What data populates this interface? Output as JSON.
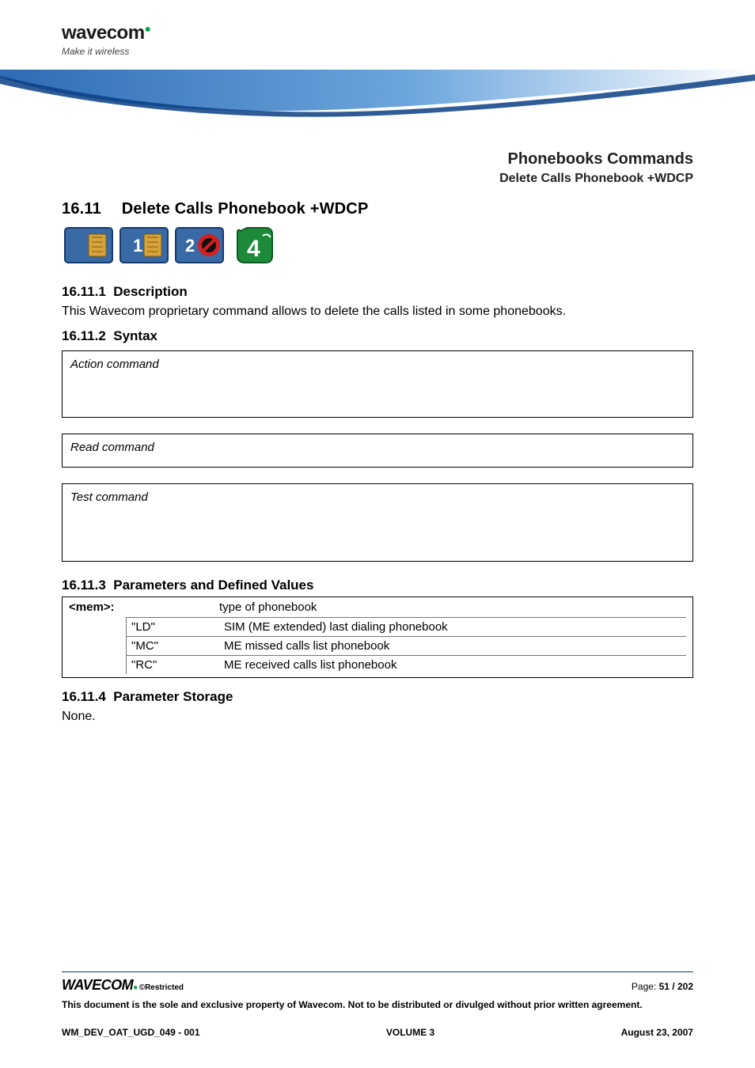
{
  "header": {
    "brand": "wavecom",
    "tagline": "Make it wireless"
  },
  "titles": {
    "chapter": "Phonebooks Commands",
    "subchapter": "Delete Calls Phonebook +WDCP"
  },
  "section": {
    "number": "16.11",
    "title": "Delete Calls Phonebook +WDCP"
  },
  "subs": {
    "desc_num": "16.11.1",
    "desc_title": "Description",
    "desc_body": "This Wavecom proprietary command allows to delete the calls listed in some phonebooks.",
    "syntax_num": "16.11.2",
    "syntax_title": "Syntax",
    "action_label": "Action command",
    "read_label": "Read command",
    "test_label": "Test command",
    "params_num": "16.11.3",
    "params_title": "Parameters and Defined Values",
    "storage_num": "16.11.4",
    "storage_title": "Parameter Storage",
    "storage_body": "None."
  },
  "params": {
    "name": "<mem>:",
    "type_label": "type of phonebook",
    "rows": [
      {
        "code": "\"LD\"",
        "desc": "SIM (ME extended) last dialing phonebook"
      },
      {
        "code": "\"MC\"",
        "desc": "ME missed calls list phonebook"
      },
      {
        "code": "\"RC\"",
        "desc": "ME received calls list phonebook"
      }
    ]
  },
  "footer": {
    "brand": "wavecom",
    "restricted": "©Restricted",
    "page_label": "Page:",
    "page_value": "51 / 202",
    "disclaimer": "This document is the sole and exclusive property of Wavecom. Not to be distributed or divulged without prior written agreement.",
    "doc_id": "WM_DEV_OAT_UGD_049 - 001",
    "volume": "VOLUME 3",
    "date": "August 23, 2007"
  },
  "icons": {
    "sim": "sim-icon",
    "one": "1",
    "two": "2",
    "four": "4"
  }
}
